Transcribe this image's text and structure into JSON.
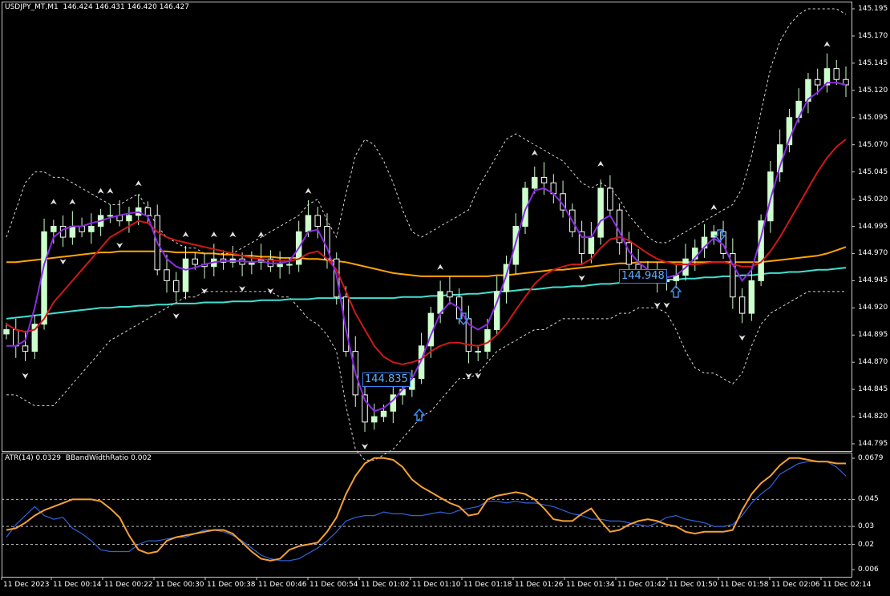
{
  "header": {
    "symbol_label": "USDJPY_MT,M1",
    "ohlc": "146.424 146.431 146.420 146.427"
  },
  "indicator_header": {
    "atr": "ATR(14) 0.0329",
    "bbw": "BBandWidthRatio 0.002"
  },
  "colors": {
    "background": "#000000",
    "frame": "#c8c8c8",
    "bull_candle": "#ccffcc",
    "bear_candle": "#ffffff",
    "bands": "#d8d8d8",
    "ma_fast": "#8a2be2",
    "ma_mid": "#d01818",
    "ma_slow": "#ffa500",
    "ma_long": "#40e0d0",
    "atr": "#2f63d8",
    "bbw": "#f7a035",
    "signal_box": "#3b82f6"
  },
  "chart_data": [
    {
      "type": "candlestick",
      "symbol": "USDJPY_MT",
      "timeframe": "M1",
      "y_ticks": [
        "145.195",
        "145.170",
        "145.145",
        "145.120",
        "145.095",
        "145.070",
        "145.045",
        "145.020",
        "144.995",
        "144.970",
        "144.945",
        "144.920",
        "144.895",
        "144.870",
        "144.845",
        "144.820",
        "144.795"
      ],
      "x_ticks": [
        "11 Dec 2023",
        "11 Dec 00:14",
        "11 Dec 00:22",
        "11 Dec 00:30",
        "11 Dec 00:38",
        "11 Dec 00:46",
        "11 Dec 00:54",
        "11 Dec 01:02",
        "11 Dec 01:10",
        "11 Dec 01:18",
        "11 Dec 01:26",
        "11 Dec 01:34",
        "11 Dec 01:42",
        "11 Dec 01:50",
        "11 Dec 01:58",
        "11 Dec 02:06",
        "11 Dec 02:14"
      ],
      "ylim": [
        144.79,
        145.2
      ],
      "price_labels": [
        {
          "text": "144.835",
          "price": 144.835,
          "time": "11 Dec 01:05"
        },
        {
          "text": "144.948",
          "price": 144.948,
          "time": "11 Dec 01:47"
        }
      ],
      "series": [
        {
          "name": "price",
          "kind": "candles",
          "close": [
            144.9,
            144.885,
            144.88,
            144.905,
            144.99,
            144.995,
            144.985,
            144.995,
            144.99,
            144.995,
            145.005,
            145.005,
            145.0,
            145.005,
            145.012,
            145.005,
            144.955,
            144.945,
            144.935,
            144.965,
            144.96,
            144.958,
            144.965,
            144.962,
            144.965,
            144.96,
            144.962,
            144.965,
            144.958,
            144.96,
            144.96,
            144.99,
            145.005,
            144.995,
            144.965,
            144.93,
            144.88,
            144.84,
            144.815,
            144.82,
            144.825,
            144.84,
            144.845,
            144.855,
            144.885,
            144.915,
            144.935,
            144.93,
            144.91,
            144.88,
            144.88,
            144.9,
            144.935,
            144.96,
            144.995,
            145.03,
            145.04,
            145.035,
            145.025,
            145.01,
            144.99,
            144.97,
            144.985,
            145.03,
            145.01,
            144.98,
            144.96,
            144.955,
            144.95,
            144.945,
            144.945,
            144.95,
            144.965,
            144.975,
            144.985,
            144.99,
            144.97,
            144.93,
            144.915,
            144.945,
            145.0,
            145.045,
            145.07,
            145.095,
            145.11,
            145.13,
            145.125,
            145.14,
            145.13,
            145.125
          ]
        },
        {
          "name": "bb_upper",
          "kind": "line",
          "style": "dashed",
          "values": [
            144.985,
            145.01,
            145.035,
            145.045,
            145.045,
            145.04,
            145.04,
            145.035,
            145.03,
            145.025,
            145.02,
            145.015,
            145.015,
            145.02,
            145.025,
            145.01,
            144.995,
            144.985,
            144.98,
            144.975,
            144.975,
            144.97,
            144.97,
            144.97,
            144.97,
            144.975,
            144.98,
            144.985,
            144.99,
            144.995,
            145.0,
            145.005,
            145.015,
            145.02,
            145.0,
            144.985,
            145.025,
            145.06,
            145.075,
            145.07,
            145.055,
            145.035,
            145.01,
            144.99,
            144.985,
            144.99,
            144.995,
            145.0,
            145.005,
            145.01,
            145.03,
            145.045,
            145.06,
            145.075,
            145.08,
            145.075,
            145.07,
            145.065,
            145.06,
            145.055,
            145.045,
            145.035,
            145.03,
            145.035,
            145.03,
            145.02,
            145.005,
            144.995,
            144.985,
            144.98,
            144.98,
            144.985,
            144.99,
            144.995,
            145.0,
            145.005,
            145.01,
            145.015,
            145.03,
            145.06,
            145.1,
            145.14,
            145.165,
            145.18,
            145.19,
            145.195,
            145.195,
            145.195,
            145.195,
            145.19
          ]
        },
        {
          "name": "bb_lower",
          "kind": "line",
          "style": "dashed",
          "values": [
            144.84,
            144.84,
            144.835,
            144.83,
            144.83,
            144.83,
            144.84,
            144.85,
            144.86,
            144.87,
            144.88,
            144.89,
            144.895,
            144.9,
            144.905,
            144.91,
            144.915,
            144.92,
            144.925,
            144.93,
            144.93,
            144.935,
            144.935,
            144.935,
            144.935,
            144.935,
            144.935,
            144.935,
            144.935,
            144.93,
            144.93,
            144.92,
            144.91,
            144.905,
            144.895,
            144.88,
            144.83,
            144.79,
            144.78,
            144.78,
            144.785,
            144.79,
            144.8,
            144.81,
            144.82,
            144.825,
            144.835,
            144.845,
            144.855,
            144.855,
            144.86,
            144.87,
            144.88,
            144.885,
            144.89,
            144.895,
            144.9,
            144.9,
            144.905,
            144.91,
            144.91,
            144.91,
            144.91,
            144.91,
            144.91,
            144.915,
            144.915,
            144.92,
            144.92,
            144.92,
            144.915,
            144.9,
            144.88,
            144.865,
            144.86,
            144.86,
            144.855,
            144.85,
            144.86,
            144.885,
            144.905,
            144.915,
            144.92,
            144.925,
            144.93,
            144.935,
            144.935,
            144.935,
            144.935,
            144.935
          ]
        },
        {
          "name": "ma_fast",
          "kind": "line",
          "values": [
            144.885,
            144.885,
            144.89,
            144.92,
            144.96,
            144.985,
            144.992,
            144.995,
            144.995,
            144.998,
            145.0,
            145.003,
            145.005,
            145.007,
            145.008,
            145.004,
            144.98,
            144.965,
            144.958,
            144.955,
            144.957,
            144.96,
            144.962,
            144.963,
            144.963,
            144.963,
            144.962,
            144.963,
            144.961,
            144.961,
            144.963,
            144.975,
            144.99,
            144.992,
            144.975,
            144.95,
            144.9,
            144.86,
            144.835,
            144.825,
            144.828,
            144.835,
            144.845,
            144.855,
            144.872,
            144.895,
            144.915,
            144.925,
            144.92,
            144.905,
            144.9,
            144.905,
            144.925,
            144.95,
            144.98,
            145.01,
            145.028,
            145.03,
            145.025,
            145.015,
            145.0,
            144.985,
            144.985,
            145.0,
            145.005,
            144.99,
            144.972,
            144.962,
            144.955,
            144.95,
            144.948,
            144.95,
            144.957,
            144.966,
            144.976,
            144.984,
            144.978,
            144.96,
            144.945,
            144.955,
            144.985,
            145.02,
            145.05,
            145.075,
            145.095,
            145.112,
            145.118,
            145.127,
            145.127,
            145.125
          ]
        },
        {
          "name": "ma_mid",
          "kind": "line",
          "values": [
            144.905,
            144.9,
            144.898,
            144.9,
            144.91,
            144.925,
            144.935,
            144.945,
            144.955,
            144.965,
            144.975,
            144.985,
            144.99,
            144.995,
            145.0,
            144.998,
            144.99,
            144.985,
            144.982,
            144.98,
            144.978,
            144.976,
            144.974,
            144.972,
            144.97,
            144.968,
            144.966,
            144.965,
            144.964,
            144.963,
            144.963,
            144.965,
            144.97,
            144.972,
            144.965,
            144.955,
            144.935,
            144.915,
            144.9,
            144.885,
            144.875,
            144.87,
            144.868,
            144.87,
            144.873,
            144.88,
            144.885,
            144.888,
            144.888,
            144.886,
            144.885,
            144.888,
            144.895,
            144.905,
            144.918,
            144.93,
            144.942,
            144.95,
            144.955,
            144.958,
            144.96,
            144.96,
            144.965,
            144.975,
            144.983,
            144.985,
            144.982,
            144.976,
            144.97,
            144.965,
            144.962,
            144.96,
            144.96,
            144.96,
            144.961,
            144.962,
            144.962,
            144.96,
            144.958,
            144.958,
            144.962,
            144.972,
            144.985,
            145.0,
            145.015,
            145.03,
            145.045,
            145.058,
            145.068,
            145.075
          ]
        },
        {
          "name": "ma_slow",
          "kind": "line",
          "values": [
            144.962,
            144.962,
            144.963,
            144.964,
            144.965,
            144.966,
            144.967,
            144.968,
            144.969,
            144.97,
            144.971,
            144.971,
            144.972,
            144.972,
            144.972,
            144.972,
            144.972,
            144.972,
            144.971,
            144.971,
            144.971,
            144.97,
            144.97,
            144.969,
            144.969,
            144.968,
            144.968,
            144.967,
            144.967,
            144.966,
            144.966,
            144.966,
            144.965,
            144.965,
            144.964,
            144.963,
            144.962,
            144.96,
            144.958,
            144.956,
            144.954,
            144.952,
            144.951,
            144.95,
            144.949,
            144.949,
            144.949,
            144.949,
            144.949,
            144.949,
            144.949,
            144.949,
            144.95,
            144.95,
            144.951,
            144.952,
            144.953,
            144.954,
            144.955,
            144.955,
            144.956,
            144.957,
            144.958,
            144.959,
            144.96,
            144.961,
            144.961,
            144.962,
            144.962,
            144.962,
            144.962,
            144.962,
            144.962,
            144.962,
            144.962,
            144.962,
            144.962,
            144.962,
            144.962,
            144.962,
            144.962,
            144.963,
            144.964,
            144.965,
            144.966,
            144.967,
            144.968,
            144.97,
            144.973,
            144.976
          ]
        },
        {
          "name": "ma_long",
          "kind": "line",
          "values": [
            144.91,
            144.911,
            144.912,
            144.913,
            144.914,
            144.915,
            144.916,
            144.917,
            144.918,
            144.919,
            144.92,
            144.92,
            144.921,
            144.921,
            144.922,
            144.922,
            144.923,
            144.923,
            144.924,
            144.924,
            144.924,
            144.925,
            144.925,
            144.925,
            144.926,
            144.926,
            144.926,
            144.927,
            144.927,
            144.927,
            144.928,
            144.928,
            144.928,
            144.929,
            144.929,
            144.929,
            144.929,
            144.929,
            144.929,
            144.929,
            144.929,
            144.929,
            144.93,
            144.93,
            144.93,
            144.931,
            144.931,
            144.932,
            144.932,
            144.933,
            144.933,
            144.934,
            144.935,
            144.935,
            144.936,
            144.937,
            144.937,
            144.938,
            144.939,
            144.939,
            144.94,
            144.94,
            144.941,
            144.942,
            144.942,
            144.943,
            144.944,
            144.944,
            144.945,
            144.945,
            144.946,
            144.946,
            144.947,
            144.947,
            144.948,
            144.948,
            144.949,
            144.949,
            144.95,
            144.95,
            144.951,
            144.952,
            144.952,
            144.953,
            144.953,
            144.954,
            144.955,
            144.955,
            144.956,
            144.957
          ]
        }
      ]
    },
    {
      "type": "line",
      "y_ticks": [
        "0.0679",
        "0.045",
        "0.03",
        "0.02",
        "0.006"
      ],
      "ylim": [
        0.006,
        0.0679
      ],
      "series": [
        {
          "name": "ATR(14)",
          "values": [
            0.024,
            0.031,
            0.036,
            0.041,
            0.036,
            0.034,
            0.035,
            0.029,
            0.026,
            0.022,
            0.017,
            0.016,
            0.016,
            0.016,
            0.02,
            0.022,
            0.022,
            0.023,
            0.024,
            0.024,
            0.026,
            0.028,
            0.028,
            0.027,
            0.025,
            0.022,
            0.018,
            0.014,
            0.012,
            0.011,
            0.011,
            0.012,
            0.015,
            0.018,
            0.022,
            0.027,
            0.033,
            0.035,
            0.036,
            0.036,
            0.038,
            0.037,
            0.037,
            0.036,
            0.036,
            0.037,
            0.038,
            0.037,
            0.039,
            0.04,
            0.041,
            0.044,
            0.044,
            0.043,
            0.044,
            0.043,
            0.043,
            0.042,
            0.041,
            0.039,
            0.037,
            0.036,
            0.034,
            0.034,
            0.033,
            0.033,
            0.032,
            0.031,
            0.03,
            0.032,
            0.035,
            0.036,
            0.034,
            0.033,
            0.032,
            0.03,
            0.03,
            0.031,
            0.036,
            0.043,
            0.048,
            0.052,
            0.059,
            0.062,
            0.065,
            0.066,
            0.066,
            0.066,
            0.063,
            0.058
          ]
        },
        {
          "name": "BBandWidthRatio",
          "values": [
            0.028,
            0.029,
            0.032,
            0.036,
            0.039,
            0.041,
            0.043,
            0.045,
            0.045,
            0.045,
            0.044,
            0.04,
            0.035,
            0.025,
            0.017,
            0.015,
            0.016,
            0.022,
            0.024,
            0.025,
            0.026,
            0.027,
            0.028,
            0.028,
            0.026,
            0.021,
            0.016,
            0.012,
            0.011,
            0.012,
            0.017,
            0.019,
            0.02,
            0.021,
            0.027,
            0.035,
            0.048,
            0.058,
            0.065,
            0.068,
            0.068,
            0.067,
            0.063,
            0.056,
            0.052,
            0.049,
            0.046,
            0.043,
            0.041,
            0.036,
            0.037,
            0.045,
            0.047,
            0.048,
            0.049,
            0.048,
            0.045,
            0.04,
            0.034,
            0.033,
            0.033,
            0.037,
            0.04,
            0.033,
            0.027,
            0.028,
            0.031,
            0.033,
            0.034,
            0.033,
            0.031,
            0.03,
            0.027,
            0.026,
            0.027,
            0.027,
            0.027,
            0.028,
            0.039,
            0.048,
            0.054,
            0.058,
            0.064,
            0.068,
            0.068,
            0.067,
            0.066,
            0.066,
            0.065,
            0.065
          ]
        }
      ]
    }
  ]
}
